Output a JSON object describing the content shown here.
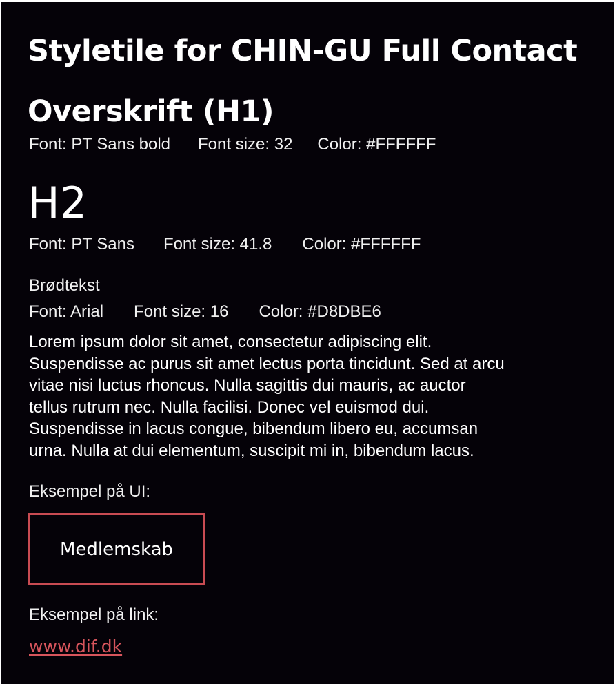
{
  "title": "Styletile for CHIN-GU Full Contact",
  "h1": {
    "sample": "Overskrift (H1)",
    "font": "Font: PT Sans bold",
    "size": "Font size: 32",
    "color": "Color: #FFFFFF"
  },
  "h2": {
    "sample": "H2",
    "font": "Font: PT Sans",
    "size": "Font size: 41.8",
    "color": "Color: #FFFFFF"
  },
  "body_text": {
    "label": "Brødtekst",
    "font": "Font: Arial",
    "size": "Font size: 16",
    "color": "Color: #D8DBE6",
    "lorem_lines": [
      "Lorem ipsum dolor sit amet, consectetur adipiscing elit.",
      "Suspendisse ac purus sit amet lectus porta tincidunt. Sed at arcu",
      "vitae nisi luctus rhoncus. Nulla sagittis dui mauris, ac auctor",
      "tellus rutrum nec. Nulla facilisi. Donec vel euismod dui.",
      "Suspendisse in lacus congue, bibendum libero eu, accumsan",
      "urna. Nulla at dui elementum, suscipit mi in, bibendum lacus."
    ]
  },
  "ui_example": {
    "label": "Eksempel på UI:",
    "button_label": "Medlemskab"
  },
  "link_example": {
    "label": "Eksempel på link:",
    "link_text": "www.dif.dk"
  },
  "colors": {
    "background": "#050208",
    "text": "#FFFFFF",
    "accent": "#C84B52"
  }
}
